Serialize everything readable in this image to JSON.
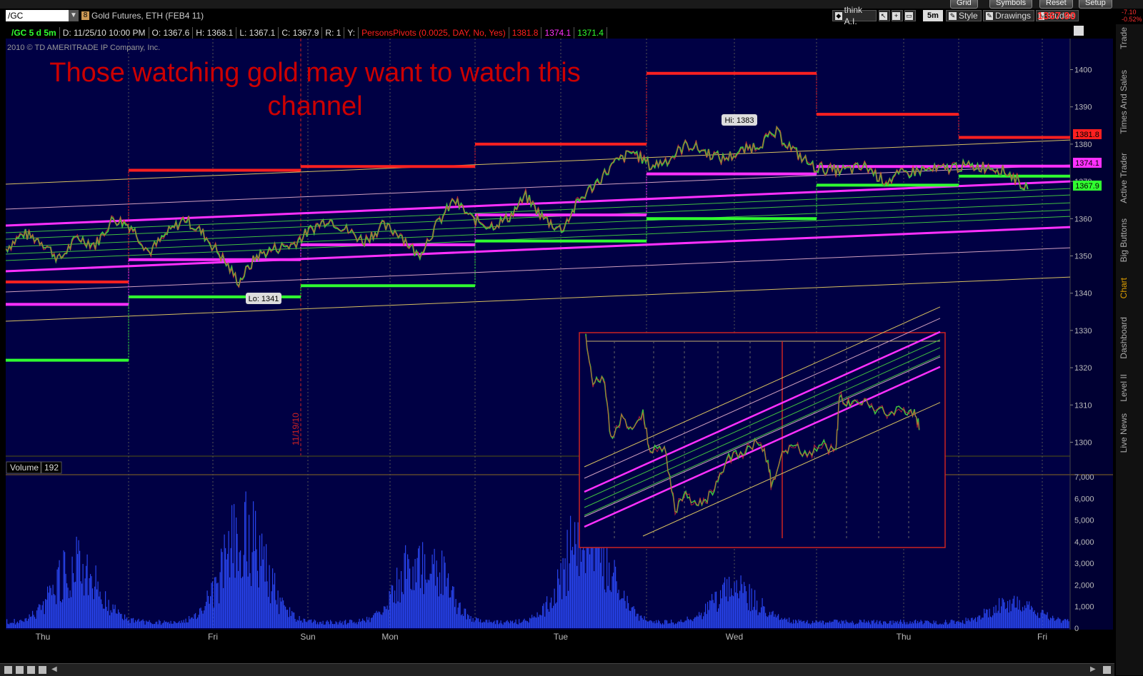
{
  "topbar": {
    "buttons": [
      "Grid",
      "Symbols",
      "Reset",
      "Setup"
    ]
  },
  "toolbar": {
    "symbol": "/GC",
    "link_badge": "8",
    "description": "Gold Futures, ETH (FEB4 11)",
    "think_ai": "think A.I.",
    "timeframe": "5m",
    "style": "Style",
    "drawings": "Drawings",
    "studies": "Studies",
    "last_price": "1367.90",
    "change": "-7.10",
    "change_pct": "-0.52%"
  },
  "info": {
    "symbol_period": "/GC 5 d 5m",
    "date": "D: 11/25/10 10:00 PM",
    "open": "O: 1367.6",
    "high": "H: 1368.1",
    "low": "L: 1367.1",
    "close": "C: 1367.9",
    "r": "R: 1",
    "y": "Y:",
    "study": "PersonsPivots (0.0025, DAY, No, Yes)",
    "pivot_r": "1381.8",
    "pivot_p": "1374.1",
    "pivot_s": "1371.4"
  },
  "copyright": "2010 © TD AMERITRADE IP Company, Inc.",
  "annotation": {
    "line1": "Those watching gold may want to watch this",
    "line2": "channel"
  },
  "markers": {
    "hi": "Hi: 1383",
    "lo": "Lo: 1341",
    "date_vertical": "11/19/10"
  },
  "price_tags": {
    "red": "1381.8",
    "magenta": "1374.1",
    "green": "1367.9"
  },
  "volume": {
    "label": "Volume",
    "value": "192"
  },
  "side_tabs": [
    "Trade",
    "Times And Sales",
    "Active Trader",
    "Big Buttons",
    "Chart",
    "Dashboard",
    "Level II",
    "Live News"
  ],
  "colors": {
    "background": "#000044",
    "red": "#ff2020",
    "magenta": "#ff30ff",
    "green": "#30ff30",
    "annotation": "#cc0000",
    "channel_outer": "#d8c060",
    "volume": "#3050ff"
  },
  "chart_data": {
    "type": "line",
    "title": "",
    "x_tick_labels": [
      "Thu",
      "Fri",
      "Sun",
      "Mon",
      "Tue",
      "Wed",
      "Thu",
      "Fri"
    ],
    "y_tick_labels": [
      1400,
      1390,
      1380,
      1370,
      1360,
      1350,
      1340,
      1330,
      1320,
      1310,
      1300
    ],
    "ylim": [
      1297,
      1408
    ],
    "volume_tick_labels": [
      "7,000",
      "6,000",
      "5,000",
      "4,000",
      "3,000",
      "2,000",
      "1,000",
      "0"
    ],
    "volume_ylim": [
      0,
      7500
    ],
    "price_path": [
      [
        0,
        1352
      ],
      [
        1,
        1356
      ],
      [
        2,
        1354
      ],
      [
        3,
        1349
      ],
      [
        4,
        1355
      ],
      [
        5,
        1353
      ],
      [
        6,
        1360
      ],
      [
        7,
        1358
      ],
      [
        8,
        1351
      ],
      [
        9,
        1356
      ],
      [
        10,
        1360
      ],
      [
        11,
        1356
      ],
      [
        12,
        1350
      ],
      [
        13,
        1343
      ],
      [
        14,
        1350
      ],
      [
        15,
        1352
      ],
      [
        16,
        1353
      ],
      [
        17,
        1357
      ],
      [
        18,
        1360
      ],
      [
        19,
        1357
      ],
      [
        20,
        1354
      ],
      [
        21,
        1358
      ],
      [
        22,
        1356
      ],
      [
        23,
        1350
      ],
      [
        24,
        1358
      ],
      [
        25,
        1365
      ],
      [
        26,
        1360
      ],
      [
        27,
        1358
      ],
      [
        28,
        1360
      ],
      [
        29,
        1366
      ],
      [
        30,
        1360
      ],
      [
        31,
        1357
      ],
      [
        32,
        1365
      ],
      [
        33,
        1370
      ],
      [
        34,
        1375
      ],
      [
        35,
        1378
      ],
      [
        36,
        1374
      ],
      [
        37,
        1376
      ],
      [
        38,
        1380
      ],
      [
        39,
        1378
      ],
      [
        40,
        1376
      ],
      [
        41,
        1378
      ],
      [
        42,
        1380
      ],
      [
        43,
        1383
      ],
      [
        44,
        1378
      ],
      [
        45,
        1374
      ],
      [
        46,
        1373
      ],
      [
        47,
        1373
      ],
      [
        48,
        1374
      ],
      [
        49,
        1370
      ],
      [
        50,
        1372
      ],
      [
        51,
        1373
      ],
      [
        52,
        1373
      ],
      [
        53,
        1374
      ],
      [
        54,
        1374
      ],
      [
        55,
        1374
      ],
      [
        56,
        1372
      ],
      [
        57,
        1367.9
      ]
    ],
    "pivots": [
      {
        "day": "Thu",
        "R": 1343,
        "P": 1337,
        "S": 1322
      },
      {
        "day": "Fri",
        "R": 1373,
        "P": 1349,
        "S": 1339
      },
      {
        "day": "Sun/Mon",
        "R": 1374,
        "P": 1353,
        "S": 1342
      },
      {
        "day": "Tue",
        "R": 1380,
        "P": 1361,
        "S": 1354
      },
      {
        "day": "Wed am",
        "R": 1399,
        "P": 1372,
        "S": 1360
      },
      {
        "day": "Wed pm",
        "R": 1388,
        "P": 1374,
        "S": 1369
      },
      {
        "day": "Thu",
        "R": 1381.8,
        "P": 1374.1,
        "S": 1371.4
      }
    ],
    "volume_peaks": [
      {
        "day": "Thu",
        "value": 3500
      },
      {
        "day": "Fri",
        "value": 5500
      },
      {
        "day": "Mon",
        "value": 4400
      },
      {
        "day": "Tue",
        "value": 6000
      },
      {
        "day": "Wed",
        "value": 2000
      },
      {
        "day": "Thu",
        "value": 1200
      }
    ]
  }
}
